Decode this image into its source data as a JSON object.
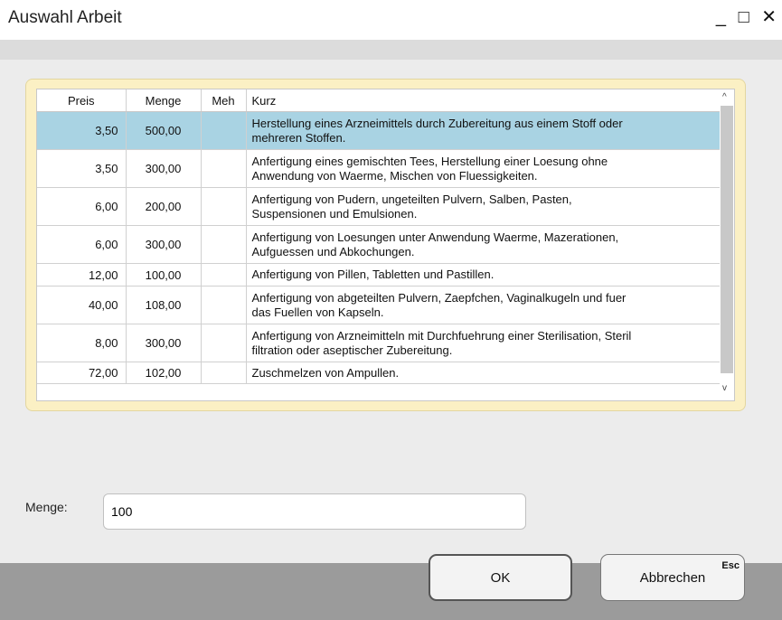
{
  "window": {
    "title": "Auswahl Arbeit",
    "controls": [
      "_",
      "□",
      "✕"
    ]
  },
  "table": {
    "columns": [
      "Preis",
      "Menge",
      "Meh",
      "Kurz"
    ],
    "rows": [
      {
        "preis": "3,50",
        "menge": "500,00",
        "meh": "",
        "kurz1": "Herstellung eines Arzneimittels durch Zubereitung aus einem Stoff oder",
        "kurz2": "mehreren Stoffen.",
        "selected": true
      },
      {
        "preis": "3,50",
        "menge": "300,00",
        "meh": "",
        "kurz1": "Anfertigung eines gemischten Tees, Herstellung einer Loesung ohne",
        "kurz2": "Anwendung von Waerme, Mischen von Fluessigkeiten."
      },
      {
        "preis": "6,00",
        "menge": "200,00",
        "meh": "",
        "kurz1": "Anfertigung von Pudern, ungeteilten Pulvern, Salben, Pasten,",
        "kurz2": "Suspensionen und Emulsionen."
      },
      {
        "preis": "6,00",
        "menge": "300,00",
        "meh": "",
        "kurz1": "Anfertigung von Loesungen unter Anwendung Waerme, Mazerationen,",
        "kurz2": "Aufguessen und Abkochungen."
      },
      {
        "preis": "12,00",
        "menge": "100,00",
        "meh": "",
        "kurz1": "Anfertigung von Pillen, Tabletten und Pastillen.",
        "kurz2": ""
      },
      {
        "preis": "40,00",
        "menge": "108,00",
        "meh": "",
        "kurz1": "Anfertigung von abgeteilten Pulvern, Zaepfchen, Vaginalkugeln und fuer",
        "kurz2": "das Fuellen von Kapseln."
      },
      {
        "preis": "8,00",
        "menge": "300,00",
        "meh": "",
        "kurz1": "Anfertigung von Arzneimitteln mit Durchfuehrung einer Sterilisation, Steril",
        "kurz2": "filtration oder aseptischer Zubereitung."
      },
      {
        "preis": "72,00",
        "menge": "102,00",
        "meh": "",
        "kurz1": "Zuschmelzen von Ampullen.",
        "kurz2": ""
      }
    ]
  },
  "form": {
    "menge_label": "Menge:",
    "menge_value": "100"
  },
  "buttons": {
    "ok": "OK",
    "cancel": "Abbrechen",
    "cancel_shortcut": "Esc"
  },
  "scroll": {
    "up": "^",
    "down": "v"
  }
}
